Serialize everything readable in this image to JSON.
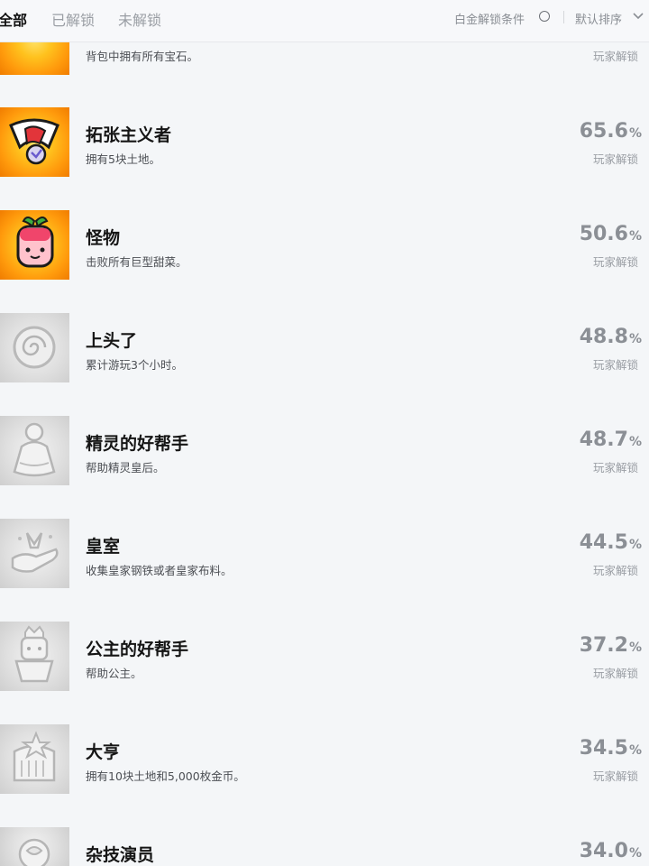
{
  "tabs": [
    {
      "label": "全部"
    },
    {
      "label": "已解锁"
    },
    {
      "label": "未解锁"
    }
  ],
  "filters": {
    "platinum_label": "白金解锁条件",
    "sort_label": "默认排序"
  },
  "percent_sign": "%",
  "achievements": [
    {
      "title": "",
      "description": "背包中拥有所有宝石。",
      "percent": "",
      "players_label": "玩家解锁",
      "icon": "gem-bag-icon",
      "unlocked": true
    },
    {
      "title": "拓张主义者",
      "description": "拥有5块土地。",
      "percent": "65.6",
      "players_label": "玩家解锁",
      "icon": "flag-sign-icon",
      "unlocked": true
    },
    {
      "title": "怪物",
      "description": "击败所有巨型甜菜。",
      "percent": "50.6",
      "players_label": "玩家解锁",
      "icon": "giant-beet-icon",
      "unlocked": true
    },
    {
      "title": "上头了",
      "description": "累计游玩3个小时。",
      "percent": "48.8",
      "players_label": "玩家解锁",
      "icon": "spiral-eye-icon",
      "unlocked": false
    },
    {
      "title": "精灵的好帮手",
      "description": "帮助精灵皇后。",
      "percent": "48.7",
      "players_label": "玩家解锁",
      "icon": "fairy-queen-icon",
      "unlocked": false
    },
    {
      "title": "皇室",
      "description": "收集皇家钢铁或者皇家布料。",
      "percent": "44.5",
      "players_label": "玩家解锁",
      "icon": "royal-hand-icon",
      "unlocked": false
    },
    {
      "title": "公主的好帮手",
      "description": "帮助公主。",
      "percent": "37.2",
      "players_label": "玩家解锁",
      "icon": "princess-icon",
      "unlocked": false
    },
    {
      "title": "大亨",
      "description": "拥有10块土地和5,000枚金币。",
      "percent": "34.5",
      "players_label": "玩家解锁",
      "icon": "tycoon-icon",
      "unlocked": false
    },
    {
      "title": "杂技演员",
      "description": "",
      "percent": "34.0",
      "players_label": "",
      "icon": "acrobat-icon",
      "unlocked": false
    }
  ],
  "colors": {
    "background": "#f4f6f8",
    "gold_icon": "#ffb01a",
    "locked_icon": "#dcdcdc",
    "percent_text": "#8b8f95"
  }
}
